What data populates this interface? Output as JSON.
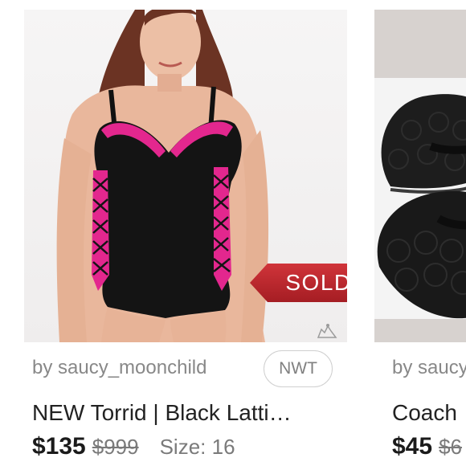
{
  "listings": [
    {
      "image_alt": "model wearing black one-piece swimsuit with pink lattice trim",
      "sold_label": "SOLD",
      "seller": "by saucy_moonchild",
      "badge": "NWT",
      "title": "NEW Torrid | Black Latti…",
      "price": "$135",
      "original_price": "$999",
      "size": "Size: 16"
    },
    {
      "image_alt": "black Coach flip flop sandals",
      "seller": "by saucy",
      "title": "Coach",
      "price": "$45",
      "original_price": "$6"
    }
  ],
  "colors": {
    "sold_ribbon": "#c1272d",
    "price_text": "#1b1b1b",
    "muted_text": "#888888"
  },
  "icons": {
    "corner": "share-icon"
  }
}
